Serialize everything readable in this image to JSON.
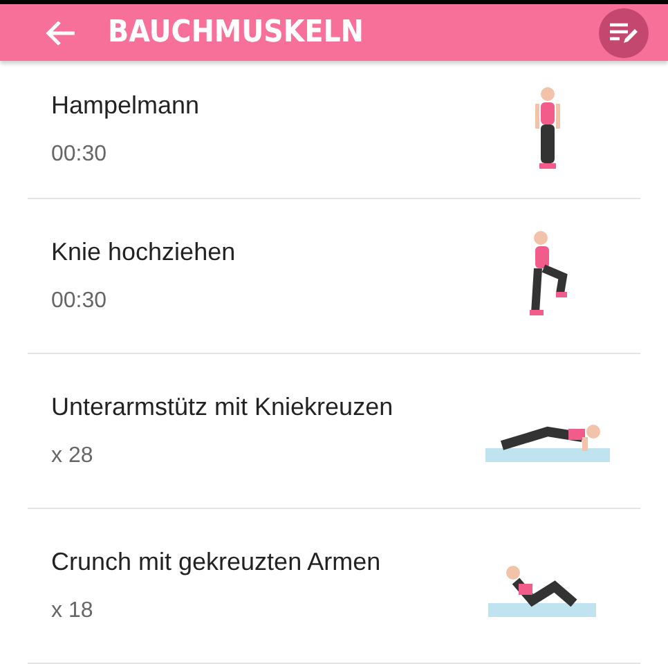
{
  "header": {
    "title": "BAUCHMUSKELN"
  },
  "exercises": [
    {
      "name": "Hampelmann",
      "amount": "00:30"
    },
    {
      "name": "Knie hochziehen",
      "amount": "00:30"
    },
    {
      "name": "Unterarmstütz mit Kniekreuzen",
      "amount": "x 28"
    },
    {
      "name": "Crunch mit gekreuzten Armen",
      "amount": "x 18"
    }
  ]
}
